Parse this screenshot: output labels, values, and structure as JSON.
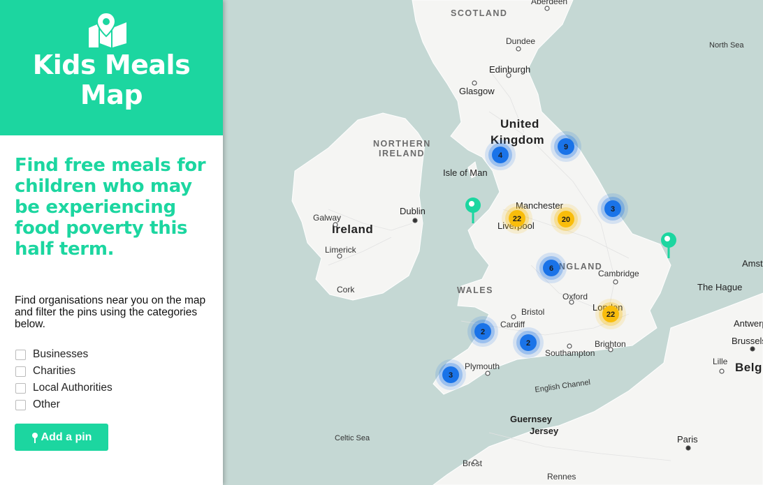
{
  "app": {
    "title_line1": "Kids Meals",
    "title_line2": "Map",
    "tagline": "Find free meals for children who may be experiencing food poverty this half term.",
    "intro": "Find organisations near you on the map and filter the pins using the categories below.",
    "add_pin_label": "Add a pin",
    "brand_color": "#1cd6a0"
  },
  "filters": [
    {
      "label": "Businesses",
      "checked": false
    },
    {
      "label": "Charities",
      "checked": false
    },
    {
      "label": "Local Authorities",
      "checked": false
    },
    {
      "label": "Other",
      "checked": false
    }
  ],
  "map": {
    "country_labels": [
      "United",
      "Kingdom",
      "Ireland"
    ],
    "region_labels": [
      "SCOTLAND",
      "NORTHERN",
      "IRELAND",
      "WALES",
      "ENGLAND"
    ],
    "city_labels": [
      "Aberdeen",
      "Dundee",
      "Edinburgh",
      "Glasgow",
      "Isle of Man",
      "Dublin",
      "Galway",
      "Limerick",
      "Cork",
      "Manchester",
      "Liverpool",
      "Cambridge",
      "Oxford",
      "Bristol",
      "Cardiff",
      "London",
      "Brighton",
      "Southampton",
      "Plymouth",
      "Guernsey",
      "Jersey",
      "Brest",
      "Rennes",
      "Paris",
      "Lille",
      "The Hague",
      "Amsterdam",
      "Antwerp",
      "Brussels",
      "Belgium"
    ],
    "sea_labels": [
      "North Sea",
      "English Channel",
      "Celtic Sea"
    ],
    "clusters": [
      {
        "count": 4,
        "color": "#1a73e8"
      },
      {
        "count": 9,
        "color": "#1a73e8"
      },
      {
        "count": 22,
        "color": "#f9bd0b"
      },
      {
        "count": 20,
        "color": "#f9bd0b"
      },
      {
        "count": 3,
        "color": "#1a73e8"
      },
      {
        "count": 6,
        "color": "#1a73e8"
      },
      {
        "count": 22,
        "color": "#f9bd0b"
      },
      {
        "count": 2,
        "color": "#1a73e8"
      },
      {
        "count": 2,
        "color": "#1a73e8"
      },
      {
        "count": 3,
        "color": "#1a73e8"
      }
    ],
    "single_pin_color": "#1cd6a0"
  }
}
